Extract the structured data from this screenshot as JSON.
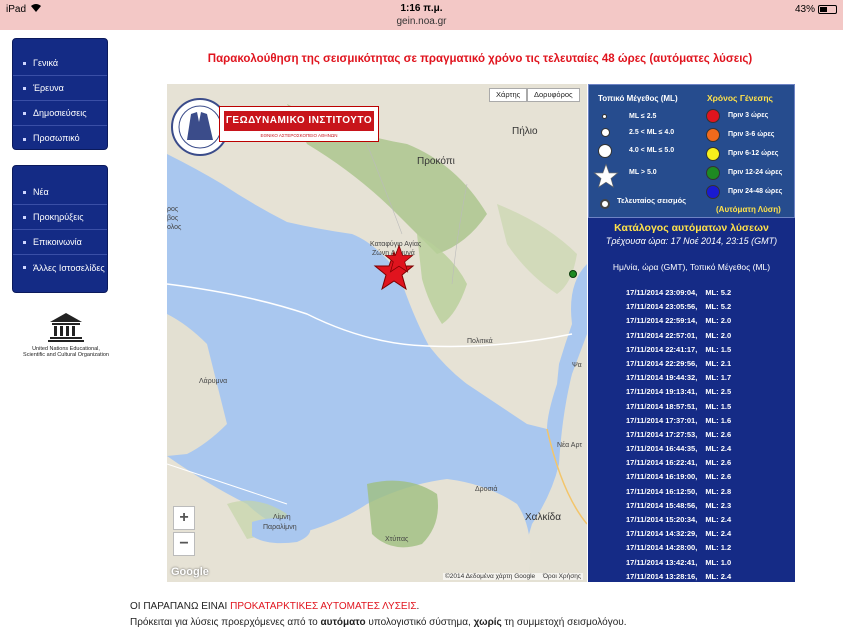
{
  "status": {
    "device": "iPad",
    "time": "1:16 π.μ.",
    "battery": "43%",
    "url": "gein.noa.gr"
  },
  "nav_primary": [
    {
      "label": "Γενικά"
    },
    {
      "label": "Έρευνα"
    },
    {
      "label": "Δημοσιεύσεις"
    },
    {
      "label": "Προσωπικό"
    }
  ],
  "nav_secondary": [
    {
      "label": "Νέα"
    },
    {
      "label": "Προκηρύξεις"
    },
    {
      "label": "Επικοινωνία"
    },
    {
      "label": "Άλλες Ιστοσελίδες"
    }
  ],
  "unesco": {
    "line1": "United Nations Educational,",
    "line2": "Scientific and Cultural Organization"
  },
  "page_title": "Παρακολούθηση της σεισμικότητας σε πραγματικό χρόνο τις τελευταίες 48 ώρες (αυτόματες λύσεις)",
  "map": {
    "btn_map": "Χάρτης",
    "btn_satellite": "Δορυφόρος",
    "zoom_in": "+",
    "zoom_out": "−",
    "google": "Google",
    "copyright": "©2014 Δεδομένα χάρτη Google",
    "terms": "Όροι Χρήσης",
    "institute_name": "ΓΕΩΔΥΝΑΜΙΚΟ ΙΝΣΤΙΤΟΥΤΟ",
    "institute_sub": "ΕΘΝΙΚΟ ΑΣΤΕΡΟΣΚΟΠΕΙΟ ΑΘΗΝΩΝ",
    "labels": {
      "pilio": "Πήλιο",
      "prokopi": "Προκόπι",
      "nw1": "ρος",
      "nw2": "βος",
      "nw3": "ολος",
      "katafygio": "Καταφύγιο Αγίας",
      "zoni": "Ζώνη Αρμυνά",
      "politika": "Πολιτικά",
      "psa": "Ψα",
      "larymna": "Λάρυμνα",
      "nea_art": "Νέα Αρτ",
      "drosia": "Δροσιά",
      "chalkida": "Χαλκίδα",
      "limni": "Λίμνη",
      "paralimni": "Παραλίμνη",
      "chtypas": "Χτύπας"
    },
    "star_color": "#e0141e"
  },
  "legend": {
    "mag_title": "Τοπικό Μέγεθος (ML)",
    "time_title": "Χρόνος Γένεσης",
    "mags": [
      "ML ≤ 2.5",
      "2.5 < ML ≤ 4.0",
      "4.0 < ML ≤ 5.0",
      "ML > 5.0"
    ],
    "last_event": "Τελευταίος σεισμός",
    "times": [
      {
        "label": "Πριν 3 ώρες",
        "color": "#e0141e"
      },
      {
        "label": "Πριν 3-6 ώρες",
        "color": "#f06a1c"
      },
      {
        "label": "Πριν 6-12 ώρες",
        "color": "#f6ef1c"
      },
      {
        "label": "Πριν 12-24 ώρες",
        "color": "#1e8a22"
      },
      {
        "label": "Πριν 24-48 ώρες",
        "color": "#1a1ad0"
      }
    ],
    "auto": "(Αυτόματη Λύση)"
  },
  "catalog": {
    "title": "Κατάλογος αυτόματων λύσεων",
    "current": "Τρέχουσα ώρα: 17 Νοέ 2014, 23:15 (GMT)",
    "header": "Ημ/νία, ώρα (GMT), Τοπικό Μέγεθος (ML)",
    "rows": [
      {
        "dt": "17/11/2014  23:09:04,",
        "ml": "ML: 5.2"
      },
      {
        "dt": "17/11/2014  23:05:56,",
        "ml": "ML: 5.2"
      },
      {
        "dt": "17/11/2014  22:59:14,",
        "ml": "ML: 2.0"
      },
      {
        "dt": "17/11/2014  22:57:01,",
        "ml": "ML: 2.0"
      },
      {
        "dt": "17/11/2014  22:41:17,",
        "ml": "ML: 1.5"
      },
      {
        "dt": "17/11/2014  22:29:56,",
        "ml": "ML: 2.1"
      },
      {
        "dt": "17/11/2014  19:44:32,",
        "ml": "ML: 1.7"
      },
      {
        "dt": "17/11/2014  19:13:41,",
        "ml": "ML: 2.5"
      },
      {
        "dt": "17/11/2014  18:57:51,",
        "ml": "ML: 1.5"
      },
      {
        "dt": "17/11/2014  17:37:01,",
        "ml": "ML: 1.6"
      },
      {
        "dt": "17/11/2014  17:27:53,",
        "ml": "ML: 2.6"
      },
      {
        "dt": "17/11/2014  16:44:35,",
        "ml": "ML: 2.4"
      },
      {
        "dt": "17/11/2014  16:22:41,",
        "ml": "ML: 2.6"
      },
      {
        "dt": "17/11/2014  16:19:00,",
        "ml": "ML: 2.6"
      },
      {
        "dt": "17/11/2014  16:12:50,",
        "ml": "ML: 2.8"
      },
      {
        "dt": "17/11/2014  15:48:56,",
        "ml": "ML: 2.3"
      },
      {
        "dt": "17/11/2014  15:20:34,",
        "ml": "ML: 2.4"
      },
      {
        "dt": "17/11/2014  14:32:29,",
        "ml": "ML: 2.4"
      },
      {
        "dt": "17/11/2014  14:28:00,",
        "ml": "ML: 1.2"
      },
      {
        "dt": "17/11/2014  13:42:41,",
        "ml": "ML: 1.0"
      },
      {
        "dt": "17/11/2014  13:28:16,",
        "ml": "ML: 2.4"
      }
    ]
  },
  "footer": {
    "line1_a": "ΟΙ ΠΑΡΑΠΑΝΩ ΕΙΝΑΙ ",
    "line1_b": "ΠΡΟΚΑΤΑΡΚΤΙΚΕΣ ΑΥΤΟΜΑΤΕΣ ΛΥΣΕΙΣ",
    "line1_c": ".",
    "line2_a": "Πρόκειται για λύσεις προερχόμενες από το ",
    "line2_b": "αυτόματο",
    "line2_c": " υπολογιστικό σύστημα, ",
    "line2_d": "χωρίς",
    "line2_e": " τη συμμετοχή σεισμολόγου."
  }
}
